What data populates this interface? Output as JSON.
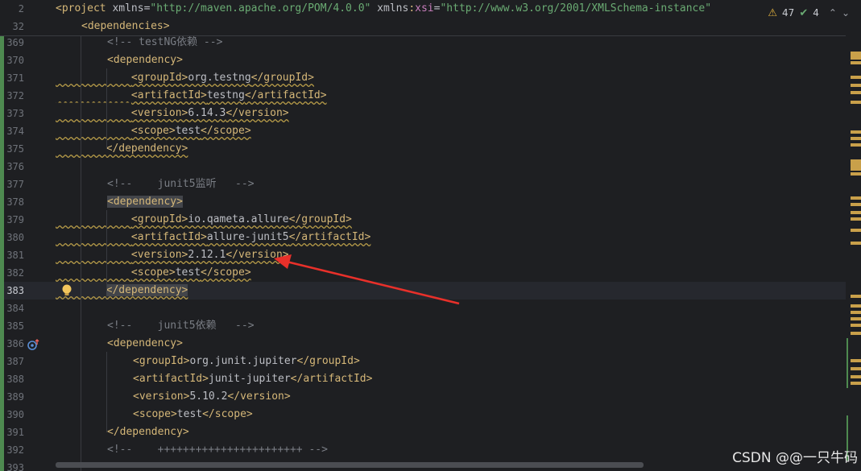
{
  "sticky_lines": [
    {
      "num": "2",
      "parts": [
        {
          "c": "tag",
          "t": "<project "
        },
        {
          "c": "attr",
          "t": "xmlns="
        },
        {
          "c": "str",
          "t": "\"http://maven.apache.org/POM/4.0.0\""
        },
        {
          "c": "attr",
          "t": " xmlns"
        },
        {
          "c": "tag",
          "t": ":"
        },
        {
          "c": "ns",
          "t": "xsi"
        },
        {
          "c": "attr",
          "t": "="
        },
        {
          "c": "str",
          "t": "\"http://www.w3.org/2001/XMLSchema-instance\""
        }
      ]
    },
    {
      "num": "32",
      "parts": [
        {
          "c": "tag",
          "t": "<dependencies>"
        }
      ]
    }
  ],
  "inspections": {
    "warnings": "47",
    "weak_warnings": "4"
  },
  "lines": [
    {
      "num": "369",
      "indent": 2,
      "parts": [
        {
          "c": "cmt",
          "t": "<!-- testNG依赖 -->"
        }
      ]
    },
    {
      "num": "370",
      "indent": 2,
      "parts": [
        {
          "c": "tag",
          "t": "<dependency>"
        }
      ]
    },
    {
      "num": "371",
      "indent": 3,
      "wavy": true,
      "parts": [
        {
          "c": "tag",
          "t": "<groupId>"
        },
        {
          "c": "txt",
          "t": "org.testng"
        },
        {
          "c": "tag",
          "t": "</groupId>"
        }
      ]
    },
    {
      "num": "372",
      "indent": 3,
      "wavy": true,
      "parts": [
        {
          "c": "tag",
          "t": "<artifactId>"
        },
        {
          "c": "txt",
          "t": "testng"
        },
        {
          "c": "tag",
          "t": "</artifactId>"
        }
      ]
    },
    {
      "num": "373",
      "indent": 3,
      "wavy": true,
      "parts": [
        {
          "c": "tag",
          "t": "<version>"
        },
        {
          "c": "txt",
          "t": "6.14.3"
        },
        {
          "c": "tag",
          "t": "</version>"
        }
      ]
    },
    {
      "num": "374",
      "indent": 3,
      "wavy": true,
      "parts": [
        {
          "c": "tag",
          "t": "<scope>"
        },
        {
          "c": "txt",
          "t": "test"
        },
        {
          "c": "tag",
          "t": "</scope>"
        }
      ]
    },
    {
      "num": "375",
      "indent": 2,
      "wavy": true,
      "parts": [
        {
          "c": "tag",
          "t": "</dependency>"
        }
      ]
    },
    {
      "num": "376",
      "indent": 0,
      "parts": []
    },
    {
      "num": "377",
      "indent": 2,
      "parts": [
        {
          "c": "cmt",
          "t": "<!--    junit5监听   -->"
        }
      ]
    },
    {
      "num": "378",
      "indent": 2,
      "parts": [
        {
          "c": "tag hl",
          "t": "<dependency>"
        }
      ]
    },
    {
      "num": "379",
      "indent": 3,
      "wavy": true,
      "parts": [
        {
          "c": "tag",
          "t": "<groupId>"
        },
        {
          "c": "txt",
          "t": "io.qameta.allure"
        },
        {
          "c": "tag",
          "t": "</groupId>"
        }
      ]
    },
    {
      "num": "380",
      "indent": 3,
      "wavy": true,
      "parts": [
        {
          "c": "tag",
          "t": "<artifactId>"
        },
        {
          "c": "txt",
          "t": "allure-junit5"
        },
        {
          "c": "tag",
          "t": "</artifactId>"
        }
      ]
    },
    {
      "num": "381",
      "indent": 3,
      "wavy": true,
      "parts": [
        {
          "c": "tag",
          "t": "<version>"
        },
        {
          "c": "txt",
          "t": "2.12.1"
        },
        {
          "c": "tag",
          "t": "</version>"
        }
      ]
    },
    {
      "num": "382",
      "indent": 3,
      "wavy": true,
      "parts": [
        {
          "c": "tag",
          "t": "<scope>"
        },
        {
          "c": "txt",
          "t": "test"
        },
        {
          "c": "tag",
          "t": "</scope>"
        }
      ]
    },
    {
      "num": "383",
      "indent": 2,
      "wavy": true,
      "current": true,
      "bulb": true,
      "parts": [
        {
          "c": "tag hl",
          "t": "</dependency>"
        }
      ]
    },
    {
      "num": "384",
      "indent": 0,
      "parts": []
    },
    {
      "num": "385",
      "indent": 2,
      "parts": [
        {
          "c": "cmt",
          "t": "<!--    junit5依赖   -->"
        }
      ]
    },
    {
      "num": "386",
      "indent": 2,
      "gicon": true,
      "parts": [
        {
          "c": "tag",
          "t": "<dependency>"
        }
      ]
    },
    {
      "num": "387",
      "indent": 3,
      "parts": [
        {
          "c": "tag",
          "t": "<groupId>"
        },
        {
          "c": "txt",
          "t": "org.junit.jupiter"
        },
        {
          "c": "tag",
          "t": "</groupId>"
        }
      ]
    },
    {
      "num": "388",
      "indent": 3,
      "parts": [
        {
          "c": "tag",
          "t": "<artifactId>"
        },
        {
          "c": "txt",
          "t": "junit-jupiter"
        },
        {
          "c": "tag",
          "t": "</artifactId>"
        }
      ]
    },
    {
      "num": "389",
      "indent": 3,
      "parts": [
        {
          "c": "tag",
          "t": "<version>"
        },
        {
          "c": "txt",
          "t": "5.10.2"
        },
        {
          "c": "tag",
          "t": "</version>"
        }
      ]
    },
    {
      "num": "390",
      "indent": 3,
      "parts": [
        {
          "c": "tag",
          "t": "<scope>"
        },
        {
          "c": "txt",
          "t": "test"
        },
        {
          "c": "tag",
          "t": "</scope>"
        }
      ]
    },
    {
      "num": "391",
      "indent": 2,
      "parts": [
        {
          "c": "tag",
          "t": "</dependency>"
        }
      ]
    },
    {
      "num": "392",
      "indent": 2,
      "parts": [
        {
          "c": "cmt",
          "t": "<!--    +++++++++++++++++++++++ -->"
        }
      ]
    },
    {
      "num": "393",
      "indent": 0,
      "parts": []
    }
  ],
  "watermark": "CSDN @@一只牛码",
  "colors": {
    "background": "#1e1f22",
    "tag": "#d5b778",
    "comment": "#7a7e85",
    "annotation_arrow": "#e8302a"
  }
}
